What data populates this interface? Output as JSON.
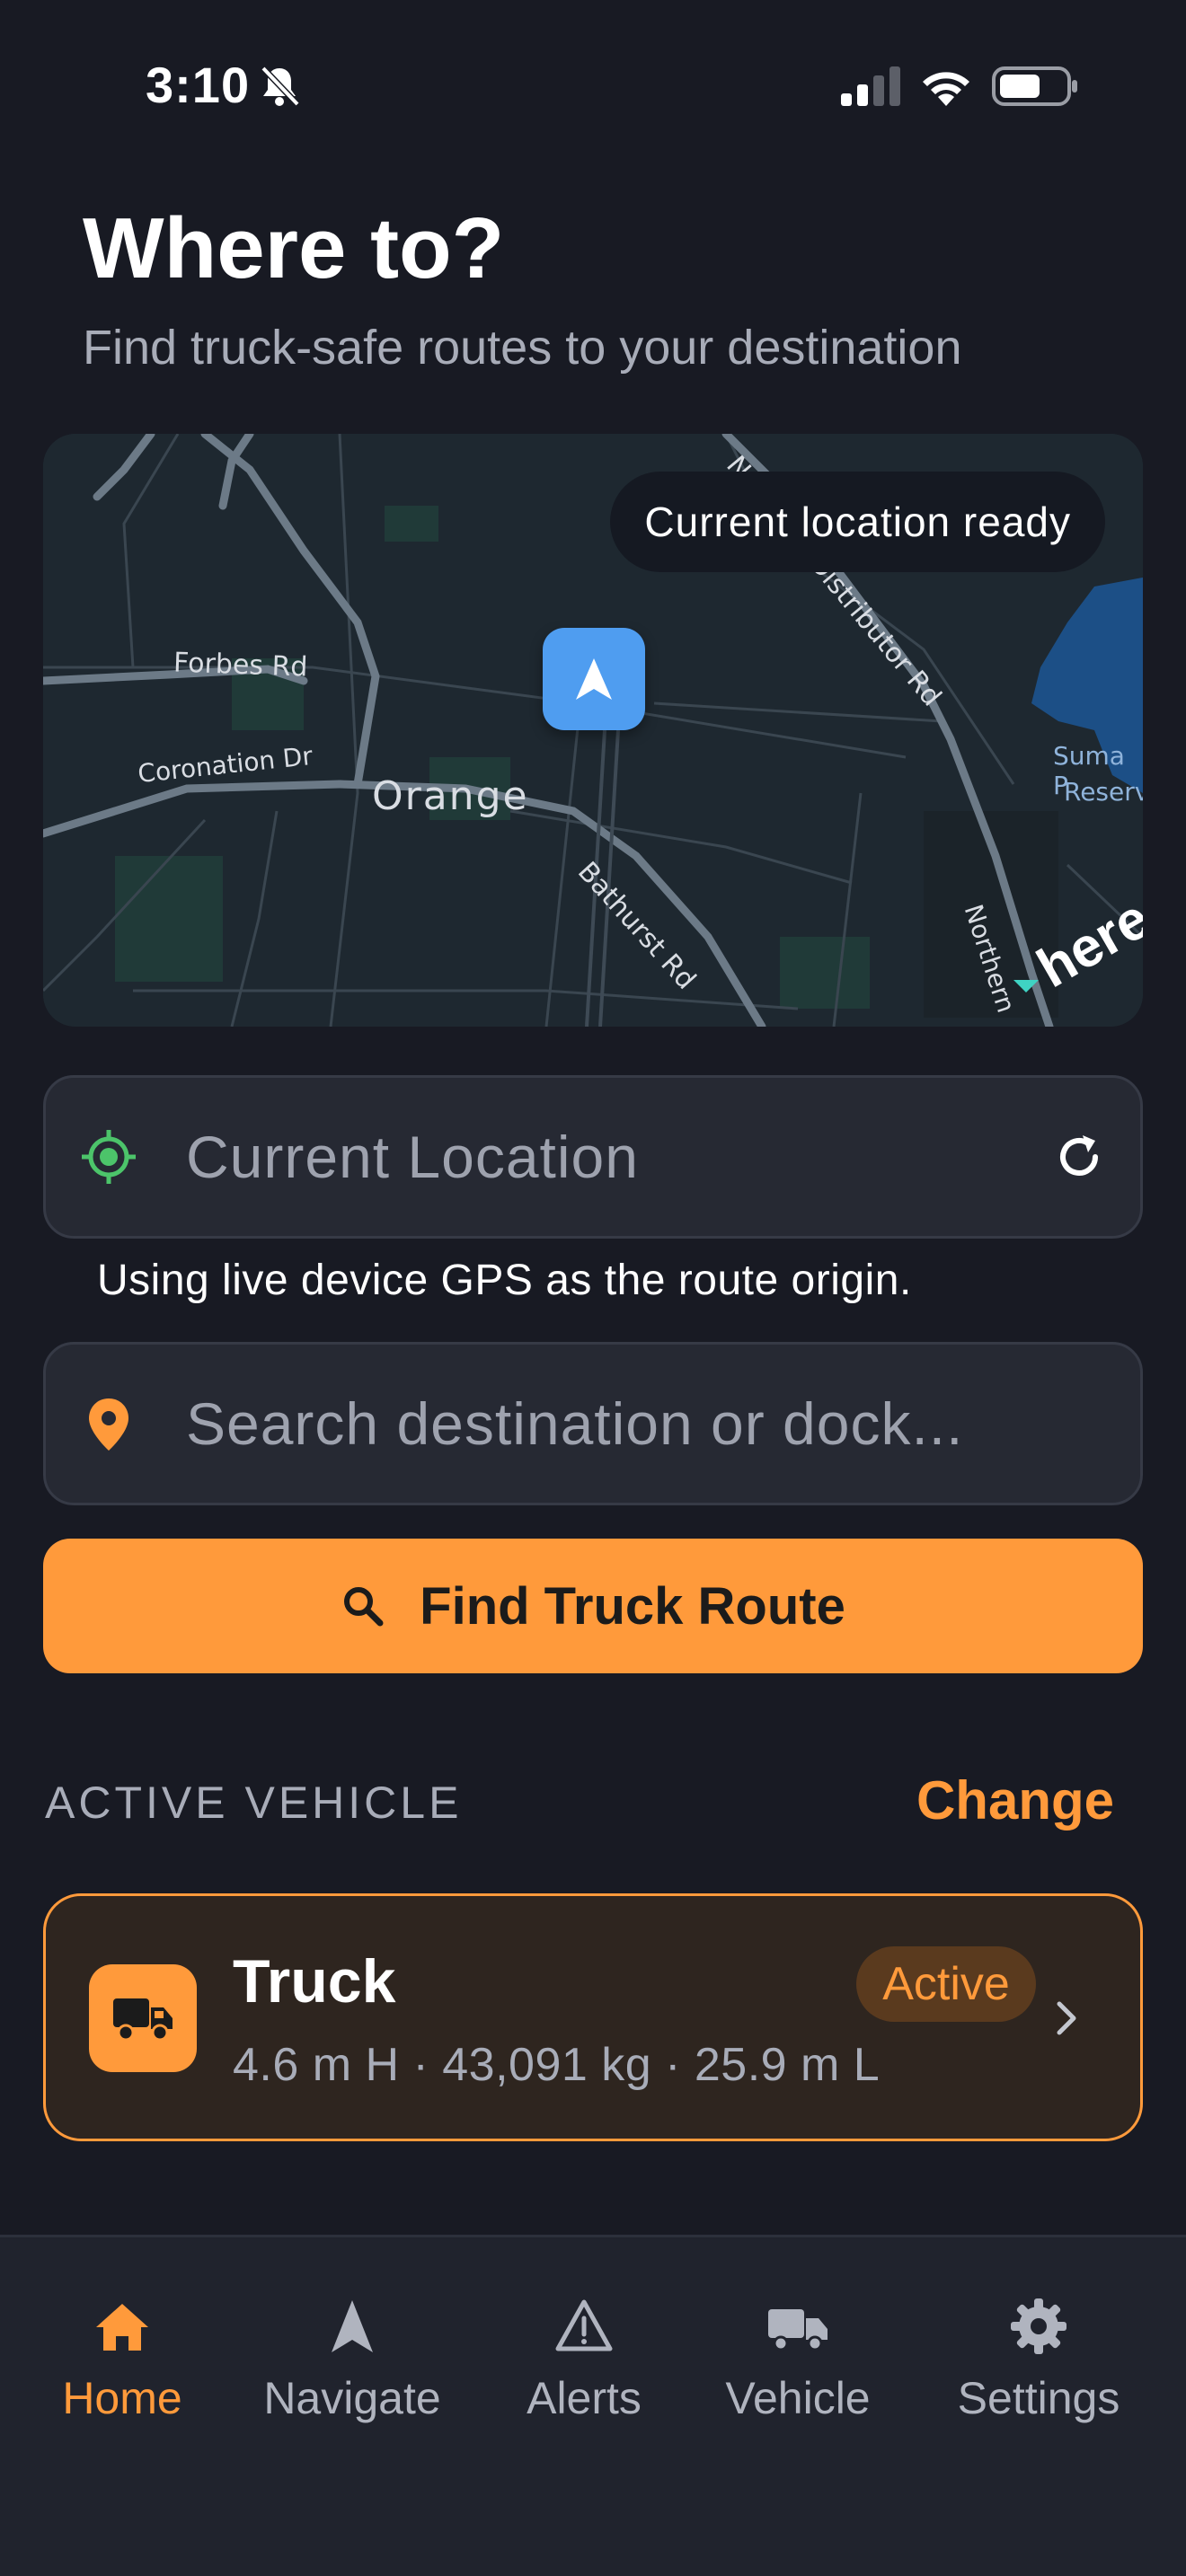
{
  "status_bar": {
    "time": "3:10"
  },
  "header": {
    "title": "Where to?",
    "subtitle": "Find truck-safe routes to your destination"
  },
  "map": {
    "status_pill": "Current location ready",
    "labels": {
      "forbes": "Forbes Rd",
      "coronation": "Coronation Dr",
      "orange": "Orange",
      "bathurst": "Bathurst Rd",
      "northern_distributor": "Northern Distributor Rd",
      "northern": "Northern",
      "suma_line1": "Suma P",
      "suma_line2": "Reserv"
    },
    "logo_text": "here"
  },
  "origin": {
    "value": "Current Location",
    "hint": "Using live device GPS as the route origin."
  },
  "destination": {
    "placeholder": "Search destination or dock..."
  },
  "find_button": {
    "label": "Find Truck Route"
  },
  "active_vehicle": {
    "section_label": "ACTIVE VEHICLE",
    "change_label": "Change",
    "name": "Truck",
    "badge": "Active",
    "specs": "4.6 m H · 43,091 kg · 25.9 m L"
  },
  "tabs": [
    {
      "label": "Home",
      "icon": "home-icon",
      "active": true
    },
    {
      "label": "Navigate",
      "icon": "navigate-icon",
      "active": false
    },
    {
      "label": "Alerts",
      "icon": "alert-icon",
      "active": false
    },
    {
      "label": "Vehicle",
      "icon": "truck-icon",
      "active": false
    },
    {
      "label": "Settings",
      "icon": "gear-icon",
      "active": false
    }
  ],
  "colors": {
    "accent": "#ff9a3b",
    "background": "#181a23",
    "marker": "#4f9df0",
    "location_green": "#4cc46a"
  }
}
